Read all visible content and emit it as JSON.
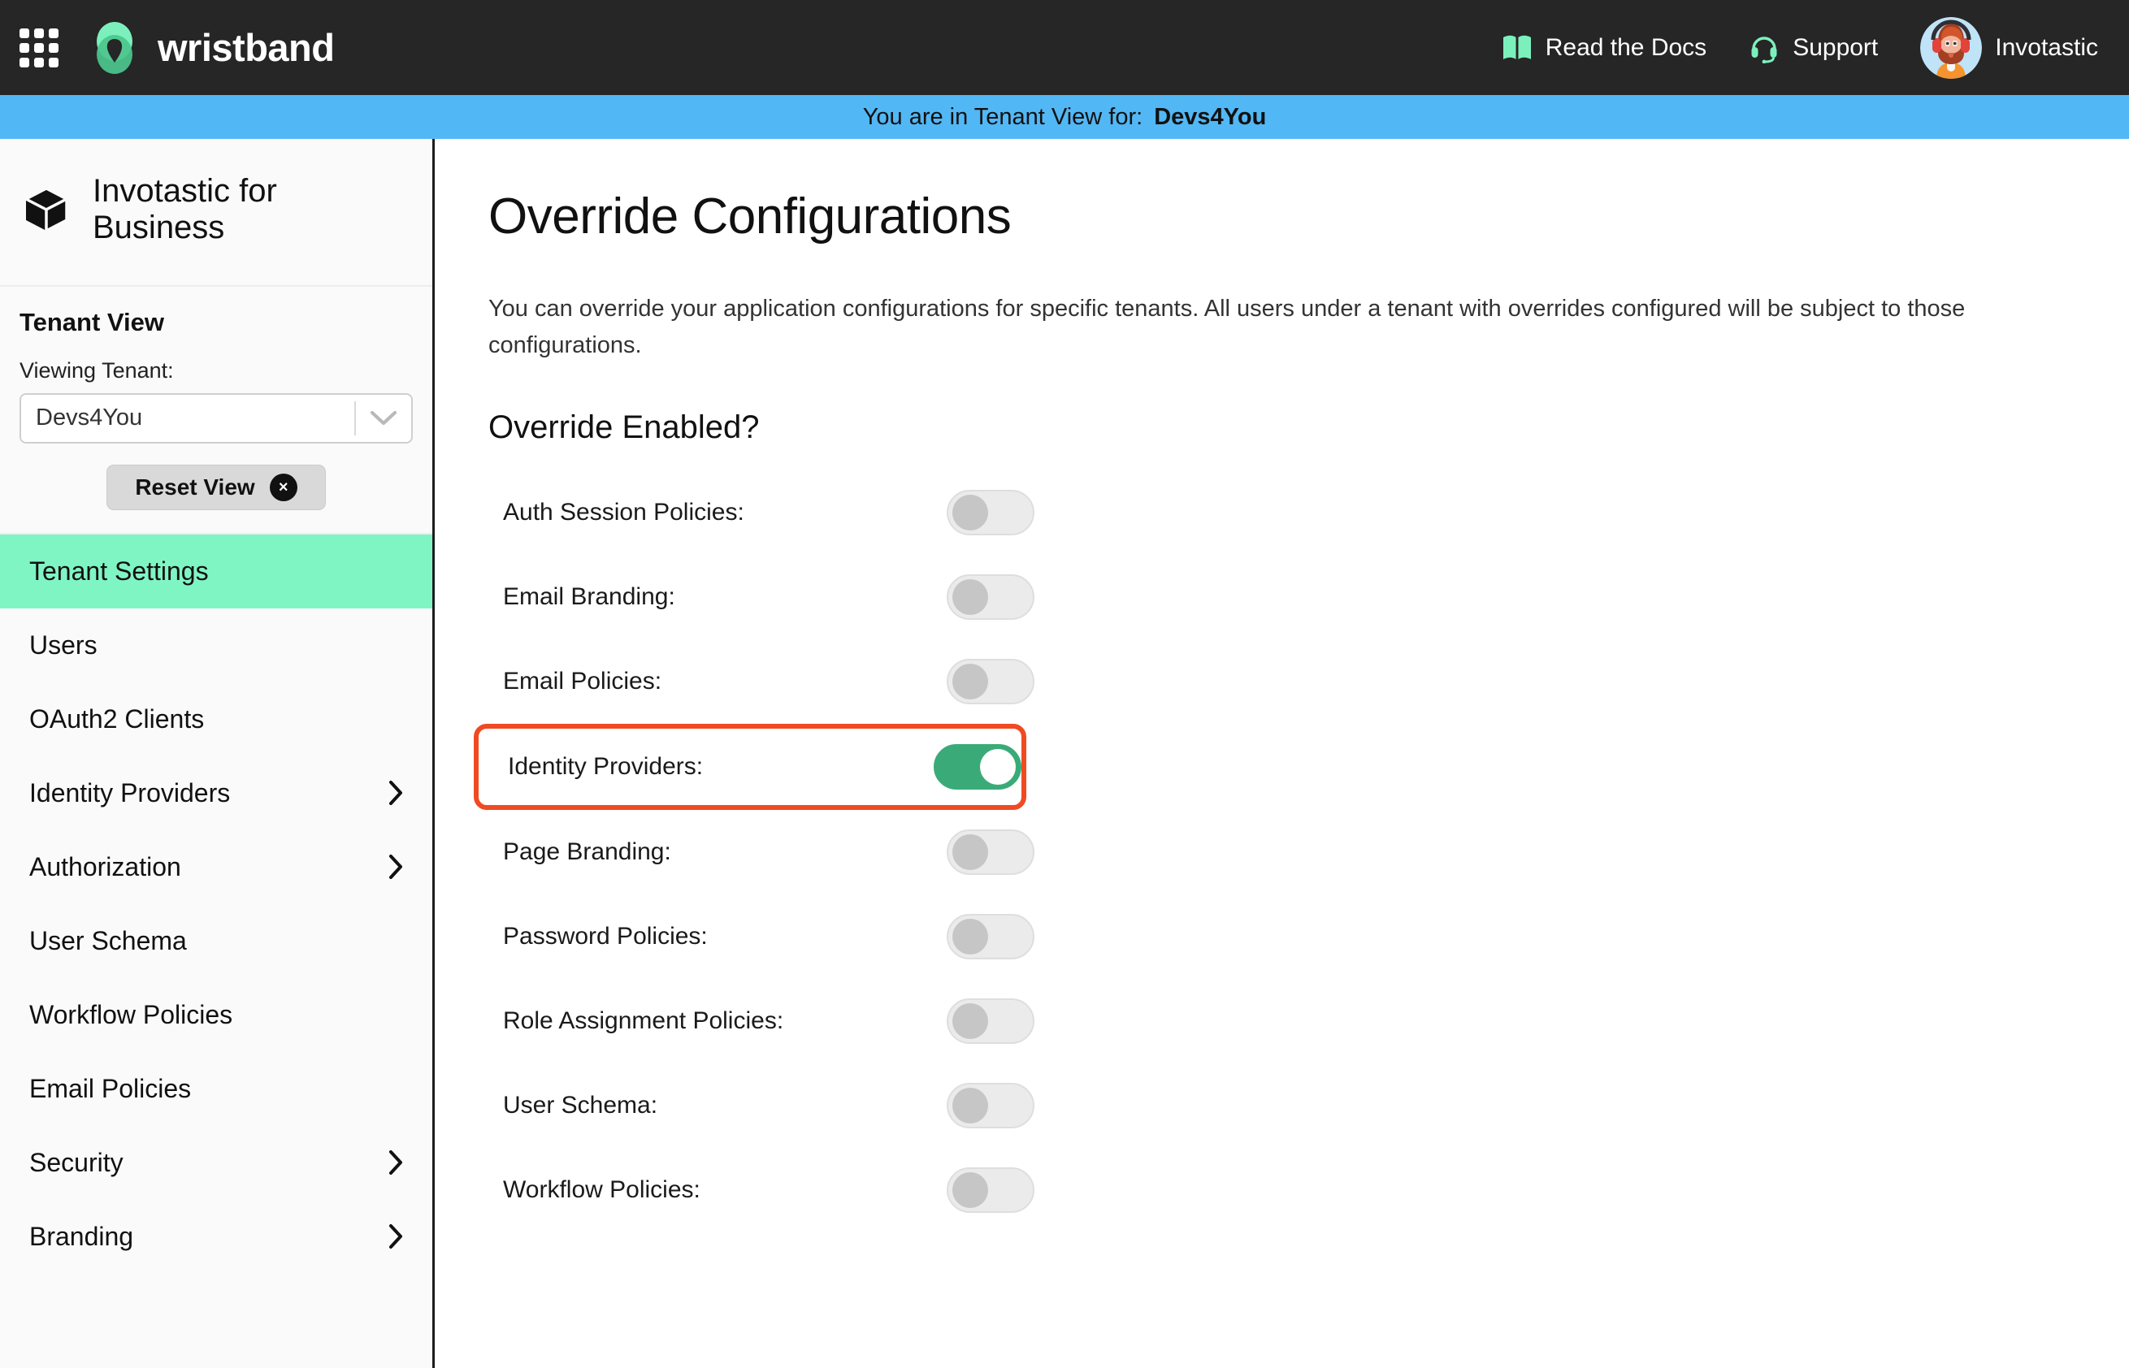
{
  "topbar": {
    "apps_icon": "grid-apps-icon",
    "brand_name": "wristband",
    "links": [
      {
        "label": "Read the Docs",
        "icon": "book-icon"
      },
      {
        "label": "Support",
        "icon": "headset-icon"
      }
    ],
    "user": {
      "name": "Invotastic",
      "avatar": "user-avatar"
    }
  },
  "tenant_banner": {
    "prefix": "You are in Tenant View for:",
    "tenant": "Devs4You"
  },
  "sidebar": {
    "app_icon": "box-icon",
    "app_title": "Invotastic for Business",
    "tenant_view": {
      "heading": "Tenant View",
      "label": "Viewing Tenant:",
      "selected": "Devs4You",
      "reset_label": "Reset View",
      "reset_badge": "×"
    },
    "nav": [
      {
        "label": "Tenant Settings",
        "active": true,
        "chevron": false
      },
      {
        "label": "Users",
        "active": false,
        "chevron": false
      },
      {
        "label": "OAuth2 Clients",
        "active": false,
        "chevron": false
      },
      {
        "label": "Identity Providers",
        "active": false,
        "chevron": true
      },
      {
        "label": "Authorization",
        "active": false,
        "chevron": true
      },
      {
        "label": "User Schema",
        "active": false,
        "chevron": false
      },
      {
        "label": "Workflow Policies",
        "active": false,
        "chevron": false
      },
      {
        "label": "Email Policies",
        "active": false,
        "chevron": false
      },
      {
        "label": "Security",
        "active": false,
        "chevron": true
      },
      {
        "label": "Branding",
        "active": false,
        "chevron": true
      }
    ]
  },
  "main": {
    "title": "Override Configurations",
    "description": "You can override your application configurations for specific tenants. All users under a tenant with overrides configured will be subject to those configurations.",
    "section_title": "Override Enabled?",
    "toggles": [
      {
        "label": "Auth Session Policies:",
        "on": false,
        "highlighted": false
      },
      {
        "label": "Email Branding:",
        "on": false,
        "highlighted": false
      },
      {
        "label": "Email Policies:",
        "on": false,
        "highlighted": false
      },
      {
        "label": "Identity Providers:",
        "on": true,
        "highlighted": true
      },
      {
        "label": "Page Branding:",
        "on": false,
        "highlighted": false
      },
      {
        "label": "Password Policies:",
        "on": false,
        "highlighted": false
      },
      {
        "label": "Role Assignment Policies:",
        "on": false,
        "highlighted": false
      },
      {
        "label": "User Schema:",
        "on": false,
        "highlighted": false
      },
      {
        "label": "Workflow Policies:",
        "on": false,
        "highlighted": false
      }
    ]
  },
  "colors": {
    "topbar_bg": "#262626",
    "banner_bg": "#52b7f5",
    "accent_mint": "#80f5c4",
    "toggle_on": "#3aab78",
    "highlight_border": "#f04a23"
  }
}
